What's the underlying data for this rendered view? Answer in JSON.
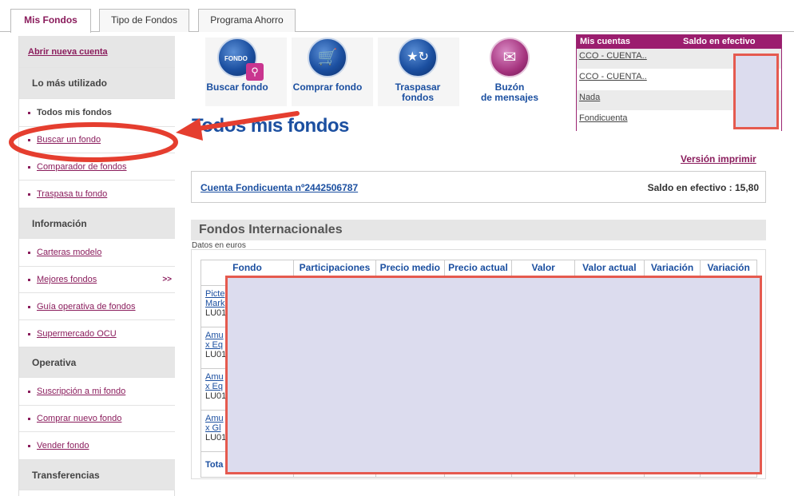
{
  "tabs": [
    {
      "label": "Mis Fondos",
      "active": true
    },
    {
      "label": "Tipo de Fondos",
      "active": false
    },
    {
      "label": "Programa Ahorro",
      "active": false
    }
  ],
  "sidebar": {
    "top_link": "Abrir nueva cuenta",
    "sections": [
      {
        "heading": "Lo más utilizado",
        "items": [
          "Todos mis fondos",
          "Buscar un fondo",
          "Comparador de fondos",
          "Traspasa tu fondo"
        ]
      },
      {
        "heading": "Información",
        "items": [
          "Carteras modelo",
          "Mejores fondos",
          "Guía operativa de fondos",
          "Supermercado OCU"
        ]
      },
      {
        "heading": "Operativa",
        "items": [
          "Suscripción a mi fondo",
          "Comprar nuevo fondo",
          "Vender fondo"
        ]
      },
      {
        "heading": "Transferencias",
        "items": []
      }
    ],
    "more_arrow": ">>"
  },
  "toolbar": {
    "search": {
      "label": "Buscar fondo",
      "badge": "FONDO",
      "icon": "search-fund-icon"
    },
    "buy": {
      "label": "Comprar fondo",
      "icon": "cart-icon"
    },
    "transfer": {
      "label": "Traspasar fondos",
      "icon": "transfer-stars-icon"
    },
    "mailbox": {
      "label_line1": "Buzón",
      "label_line2": "de mensajes",
      "icon": "envelope-icon"
    }
  },
  "accounts": {
    "heading_accounts": "Mis cuentas",
    "heading_balance": "Saldo en efectivo",
    "rows": [
      "CCO - CUENTA..",
      "CCO - CUENTA..",
      "Nada",
      "Fondicuenta"
    ]
  },
  "main": {
    "title": "Todos mis fondos",
    "print_link": "Versión imprimir",
    "account_name": "Cuenta Fondicuenta nº2442506787",
    "account_balance": "Saldo en efectivo : 15,80",
    "section_title": "Fondos Internacionales",
    "section_sub": "Datos en euros"
  },
  "funds_table": {
    "columns": [
      "Fondo",
      "Participaciones",
      "Precio medio",
      "Precio actual",
      "Valor",
      "Valor actual",
      "Variación",
      "Variación"
    ],
    "rows": [
      [
        "Picte",
        "Mark",
        "LU01"
      ],
      [
        "Amu",
        "x Eq",
        "LU01"
      ],
      [
        "Amu",
        "x Eq",
        "LU01"
      ],
      [
        "Amu",
        "x Gl",
        "LU01"
      ]
    ],
    "total_label": "Tota"
  },
  "colors": {
    "brand": "#8a1c5c",
    "blue": "#1b4fa0",
    "annotation": "#e53e2f",
    "redaction": "#dcdcee"
  }
}
